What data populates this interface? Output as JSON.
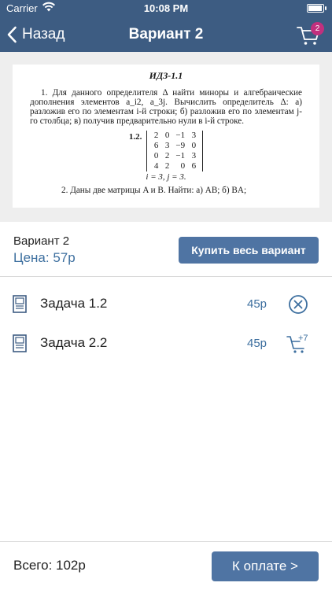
{
  "status_bar": {
    "carrier": "Carrier",
    "time": "10:08 PM"
  },
  "nav": {
    "back_label": "Назад",
    "title": "Вариант 2",
    "cart_count": "2"
  },
  "preview": {
    "heading": "ИДЗ-1.1",
    "paragraph": "1. Для данного определителя Δ найти миноры и алгебраические дополнения элементов a_i2, a_3j. Вычислить определитель Δ: а) разложив его по элементам i-й строки; б) разложив его по элементам j-го столбца; в) получив предварительно нули в i-й строке.",
    "matrix_label": "1.2.",
    "matrix": [
      [
        "2",
        "0",
        "−1",
        "3"
      ],
      [
        "6",
        "3",
        "−9",
        "0"
      ],
      [
        "0",
        "2",
        "−1",
        "3"
      ],
      [
        "4",
        "2",
        "0",
        "6"
      ]
    ],
    "condition": "i = 3, j = 3.",
    "paragraph2": "2. Даны две матрицы A и B. Найти: а) AB; б) BA;"
  },
  "variant": {
    "name": "Вариант 2",
    "price": "Цена: 57р",
    "buy_label": "Купить весь вариант"
  },
  "tasks": [
    {
      "name": "Задача 1.2",
      "price": "45р",
      "action_icon": "remove-circle-icon"
    },
    {
      "name": "Задача 2.2",
      "price": "45р",
      "action_icon": "add-to-cart-icon"
    }
  ],
  "footer": {
    "total": "Всего: 102р",
    "pay_label": "К оплате >"
  },
  "colors": {
    "header": "#3d5c82",
    "accent": "#4f74a3",
    "price": "#3d6f9f",
    "badge": "#c2307e"
  }
}
